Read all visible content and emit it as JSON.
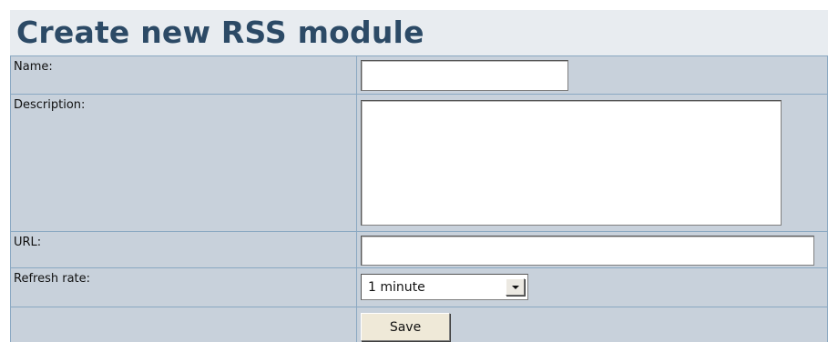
{
  "page": {
    "title": "Create new RSS module"
  },
  "form": {
    "name": {
      "label": "Name:",
      "value": ""
    },
    "description": {
      "label": "Description:",
      "value": ""
    },
    "url": {
      "label": "URL:",
      "value": ""
    },
    "refresh_rate": {
      "label": "Refresh rate:",
      "selected": "1 minute",
      "arrow_icon": "dropdown-arrow-icon"
    },
    "save_label": "Save"
  },
  "colors": {
    "title": "#2c4a66",
    "header_background": "#e8ecf0",
    "cell_background": "#c8d1db",
    "cell_border": "#8aa8c2",
    "button_background": "#efe9d8"
  }
}
